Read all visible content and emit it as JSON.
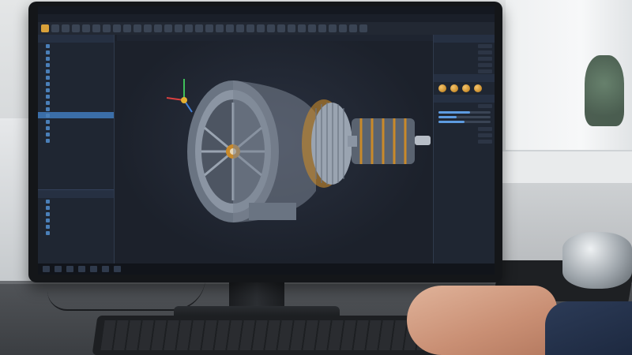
{
  "app": {
    "title": "",
    "menus": [],
    "tabs": []
  },
  "scene": {
    "monitor_brand": "",
    "viewport_model": "electric-motor-exploded-assembly"
  },
  "colors": {
    "accent": "#3b6ea8",
    "highlight": "#d9a13a",
    "copper": "#c98a2a",
    "panel": "#1f2632",
    "viewport": "#1c212b"
  },
  "icons": {
    "axis_gizmo": "axis-gizmo-icon",
    "search": "search-icon",
    "settings": "gear-icon"
  }
}
